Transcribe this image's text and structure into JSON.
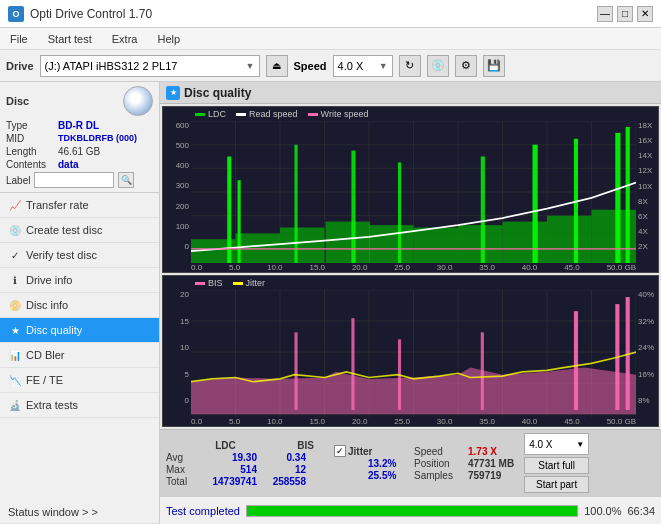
{
  "titlebar": {
    "title": "Opti Drive Control 1.70",
    "icon": "O",
    "minimize": "—",
    "maximize": "□",
    "close": "✕"
  },
  "menubar": {
    "items": [
      "File",
      "Start test",
      "Extra",
      "Help"
    ]
  },
  "drivebar": {
    "label": "Drive",
    "drive_value": "(J:)  ATAPI iHBS312  2 PL17",
    "speed_label": "Speed",
    "speed_value": "4.0 X"
  },
  "disc": {
    "title": "Disc",
    "type_label": "Type",
    "type_value": "BD-R DL",
    "mid_label": "MID",
    "mid_value": "TDKBLDRFB (000)",
    "length_label": "Length",
    "length_value": "46.61 GB",
    "contents_label": "Contents",
    "contents_value": "data",
    "label_label": "Label"
  },
  "nav": {
    "items": [
      {
        "id": "transfer-rate",
        "label": "Transfer rate",
        "icon": "📈"
      },
      {
        "id": "create-test-disc",
        "label": "Create test disc",
        "icon": "💿"
      },
      {
        "id": "verify-test-disc",
        "label": "Verify test disc",
        "icon": "✓"
      },
      {
        "id": "drive-info",
        "label": "Drive info",
        "icon": "ℹ"
      },
      {
        "id": "disc-info",
        "label": "Disc info",
        "icon": "📀"
      },
      {
        "id": "disc-quality",
        "label": "Disc quality",
        "icon": "★",
        "active": true
      },
      {
        "id": "cd-bler",
        "label": "CD Bler",
        "icon": "📊"
      },
      {
        "id": "fe-te",
        "label": "FE / TE",
        "icon": "📉"
      },
      {
        "id": "extra-tests",
        "label": "Extra tests",
        "icon": "🔬"
      }
    ]
  },
  "disc_quality": {
    "title": "Disc quality",
    "chart1": {
      "legend": [
        {
          "label": "LDC",
          "color": "#00cc00"
        },
        {
          "label": "Read speed",
          "color": "#ffffff"
        },
        {
          "label": "Write speed",
          "color": "#ff69b4"
        }
      ],
      "y_left": [
        "600",
        "500",
        "400",
        "300",
        "200",
        "100",
        "0"
      ],
      "y_right": [
        "18X",
        "16X",
        "14X",
        "12X",
        "10X",
        "8X",
        "6X",
        "4X",
        "2X"
      ],
      "x_labels": [
        "0.0",
        "5.0",
        "10.0",
        "15.0",
        "20.0",
        "25.0",
        "30.0",
        "35.0",
        "40.0",
        "45.0",
        "50.0 GB"
      ]
    },
    "chart2": {
      "legend": [
        {
          "label": "BIS",
          "color": "#ff69b4"
        },
        {
          "label": "Jitter",
          "color": "#ffff00"
        }
      ],
      "y_left": [
        "20",
        "15",
        "10",
        "5",
        "0"
      ],
      "y_right": [
        "40%",
        "32%",
        "24%",
        "16%",
        "8%"
      ],
      "x_labels": [
        "0.0",
        "5.0",
        "10.0",
        "15.0",
        "20.0",
        "25.0",
        "30.0",
        "35.0",
        "40.0",
        "45.0",
        "50.0 GB"
      ]
    },
    "stats": {
      "columns": [
        "LDC",
        "BIS"
      ],
      "jitter_label": "Jitter",
      "jitter_checked": true,
      "avg_label": "Avg",
      "max_label": "Max",
      "total_label": "Total",
      "ldc_avg": "19.30",
      "ldc_max": "514",
      "ldc_total": "14739741",
      "bis_avg": "0.34",
      "bis_max": "12",
      "bis_total": "258558",
      "jitter_avg": "13.2%",
      "jitter_max": "25.5%",
      "speed_label": "Speed",
      "speed_value": "1.73 X",
      "speed_unit_label": "Speed",
      "speed_unit_value": "4.0 X",
      "position_label": "Position",
      "position_value": "47731 MB",
      "samples_label": "Samples",
      "samples_value": "759719",
      "start_full_label": "Start full",
      "start_part_label": "Start part"
    }
  },
  "statusbar": {
    "status_text": "Test completed",
    "progress": 100,
    "progress_text": "100.0%",
    "time_text": "66:34"
  },
  "status_window_label": "Status window > >"
}
